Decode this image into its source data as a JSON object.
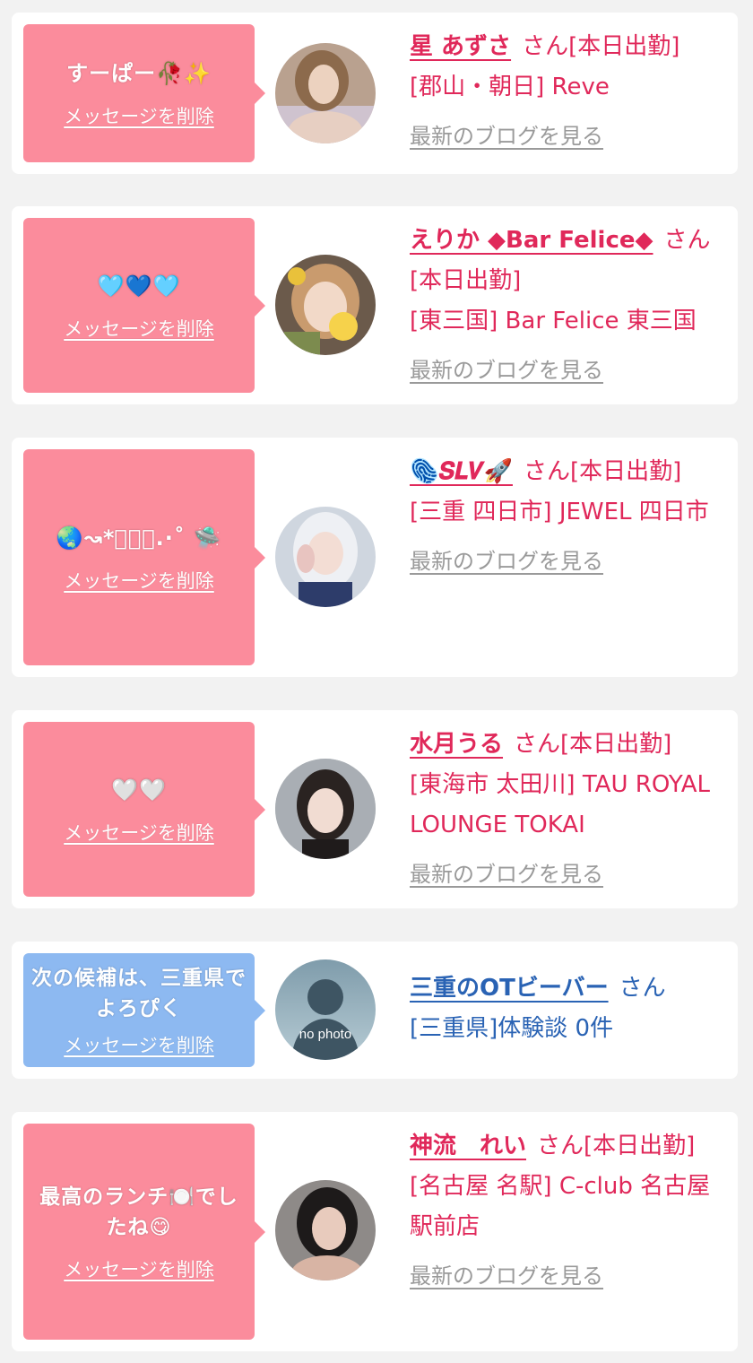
{
  "delete_label": "メッセージを削除",
  "blog_label": "最新のブログを見る",
  "colors": {
    "bubble_pink": "#fb8c9c",
    "bubble_blue": "#8db9f1",
    "name_pink": "#e0285a",
    "name_blue": "#2a63b4",
    "link_gray": "#9a9a9a"
  },
  "items": [
    {
      "message": "すーぱー🥀✨",
      "name": "星 あずさ",
      "suffix": "さん[本日出勤]",
      "location": "[郡山・朝日] Reve",
      "blog": "最新のブログを見る"
    },
    {
      "message": "🩵💙🩵",
      "name": "えりか ◆Bar Felice◆",
      "suffix": "さん[本日出勤]",
      "location": "[東三国] Bar Felice 東三国",
      "blog": "最新のブログを見る"
    },
    {
      "message": "🌏↝*ﾟ･｡.·˚ 🛸",
      "name": "🫆𝑺𝑳𝑽🚀",
      "suffix": "さん[本日出勤]",
      "location": "[三重 四日市] JEWEL 四日市",
      "blog": "最新のブログを見る"
    },
    {
      "message": "🤍🤍",
      "name": "水月うる",
      "suffix": "さん[本日出勤]",
      "location": "[東海市 太田川] TAU ROYAL LOUNGE TOKAI",
      "blog": "最新のブログを見る"
    },
    {
      "message": "次の候補は、三重県でよろぴく",
      "name": "三重のOTビーバー",
      "suffix": "さん",
      "location": "[三重県]体験談 0件",
      "avatar_text": "no photo"
    },
    {
      "message": "最高のランチ🍽️でしたね😋",
      "name": "神流　れい",
      "suffix": "さん[本日出勤]",
      "location": "[名古屋 名駅] C-club 名古屋駅前店",
      "blog": "最新のブログを見る"
    }
  ]
}
